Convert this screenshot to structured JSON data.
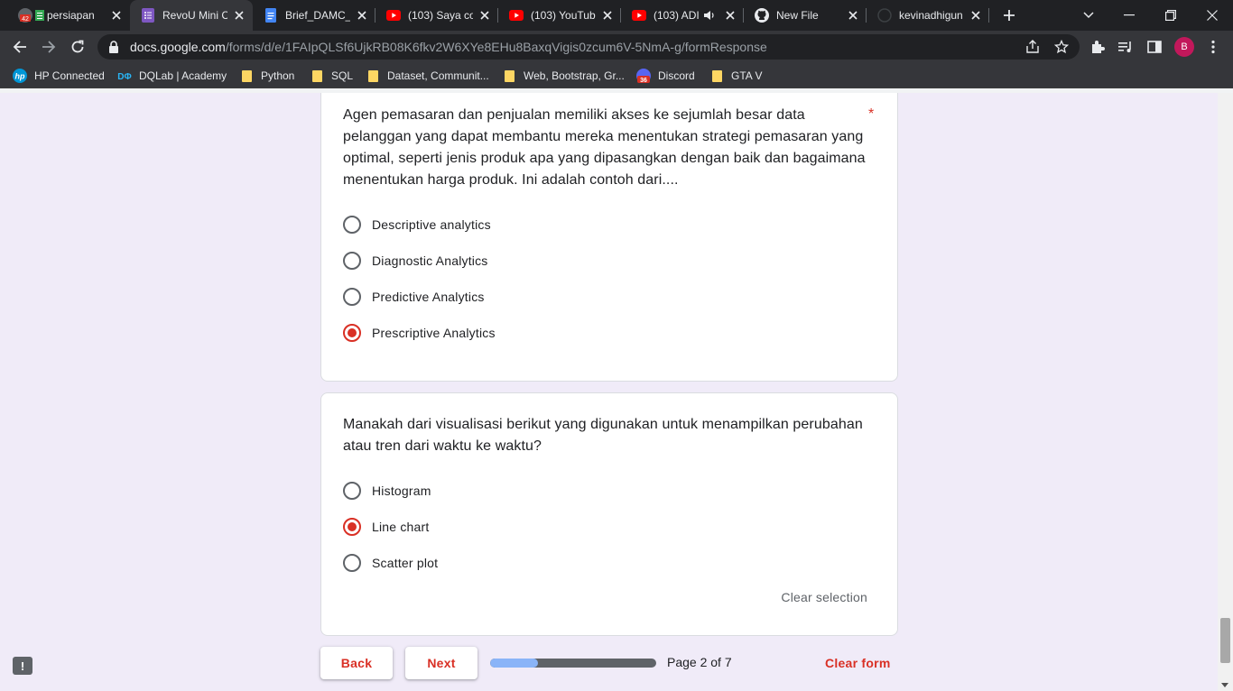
{
  "browser": {
    "tabs": [
      {
        "label": "persiapan",
        "badge": "42",
        "active": false
      },
      {
        "label": "RevoU Mini C",
        "active": true
      },
      {
        "label": "Brief_DAMC_I",
        "active": false
      },
      {
        "label": "(103) Saya co",
        "active": false
      },
      {
        "label": "(103) YouTub",
        "active": false
      },
      {
        "label": "(103) ADI",
        "active": false
      },
      {
        "label": "New File",
        "active": false
      },
      {
        "label": "kevinadhigun",
        "active": false
      }
    ],
    "url_host": "docs.google.com",
    "url_path": "/forms/d/e/1FAIpQLSf6UjkRB08K6fkv2W6XYe8EHu8BaxqVigis0zcum6V-5NmA-g/formResponse",
    "profile_initial": "B",
    "bookmarks": [
      {
        "label": "HP Connected",
        "icon": "hp-icon"
      },
      {
        "label": "DQLab | Academy",
        "icon": "dqlab-icon"
      },
      {
        "label": "Python",
        "icon": "folder-icon"
      },
      {
        "label": "SQL",
        "icon": "folder-icon"
      },
      {
        "label": "Dataset, Communit...",
        "icon": "folder-icon"
      },
      {
        "label": "Web, Bootstrap, Gr...",
        "icon": "folder-icon"
      },
      {
        "label": "Discord",
        "icon": "discord-icon",
        "badge": "36"
      },
      {
        "label": "GTA V",
        "icon": "folder-icon"
      }
    ]
  },
  "form": {
    "q1": {
      "text": "Agen pemasaran dan penjualan memiliki akses ke sejumlah besar data pelanggan yang dapat membantu mereka menentukan strategi pemasaran yang optimal, seperti jenis produk apa yang dipasangkan dengan baik dan bagaimana menentukan harga produk. Ini adalah contoh dari....",
      "required_mark": "*",
      "options": [
        "Descriptive analytics",
        "Diagnostic Analytics",
        "Predictive Analytics",
        "Prescriptive Analytics"
      ],
      "selected": "Prescriptive Analytics"
    },
    "q2": {
      "text": "Manakah dari visualisasi berikut yang digunakan untuk menampilkan perubahan atau tren dari waktu ke waktu?",
      "options": [
        "Histogram",
        "Line chart",
        "Scatter plot"
      ],
      "selected": "Line chart",
      "clear_selection": "Clear selection"
    },
    "nav": {
      "back": "Back",
      "next": "Next",
      "page_indicator": "Page 2 of 7",
      "progress_fraction": 0.2857,
      "clear_form": "Clear form"
    },
    "feedback_glyph": "!"
  },
  "colors": {
    "accent": "#d93025",
    "page_bg": "#f0ebf8",
    "progress_fill": "#8ab4f8"
  }
}
